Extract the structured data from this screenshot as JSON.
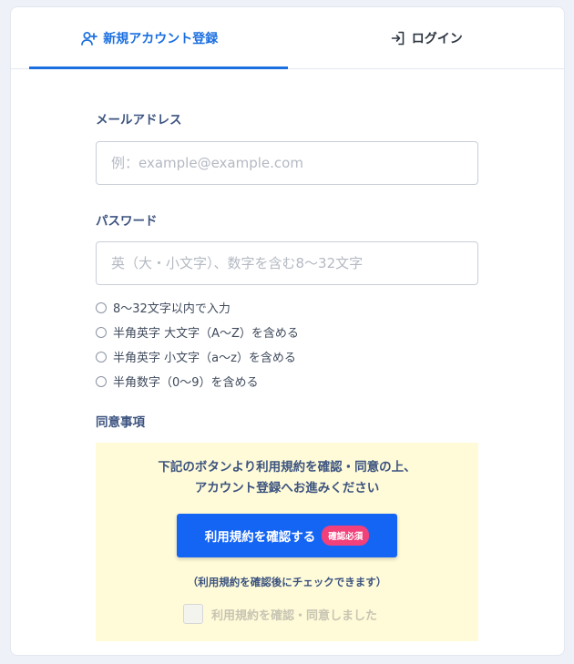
{
  "tabs": {
    "register": {
      "label": "新規アカウント登録",
      "icon": "user-plus-icon"
    },
    "login": {
      "label": "ログイン",
      "icon": "login-icon"
    }
  },
  "form": {
    "email": {
      "label": "メールアドレス",
      "placeholder": "例：example@example.com",
      "value": ""
    },
    "password": {
      "label": "パスワード",
      "placeholder": "英（大・小文字）、数字を含む8〜32文字",
      "value": ""
    },
    "rules": [
      "8〜32文字以内で入力",
      "半角英字 大文字（A〜Z）を含める",
      "半角英字 小文字（a〜z）を含める",
      "半角数字（0〜9）を含める"
    ],
    "agreement": {
      "label": "同意事項",
      "text_line1": "下記のボタンより利用規約を確認・同意の上、",
      "text_line2": "アカウント登録へお進みください",
      "button_label": "利用規約を確認する",
      "badge": "確認必須",
      "note": "（利用規約を確認後にチェックできます）",
      "checkbox_label": "利用規約を確認・同意しました",
      "checked": false
    }
  },
  "colors": {
    "accent": "#1b6fe0",
    "button": "#1565f5",
    "badge": "#f2407a",
    "agree_bg": "#fffbd8"
  }
}
